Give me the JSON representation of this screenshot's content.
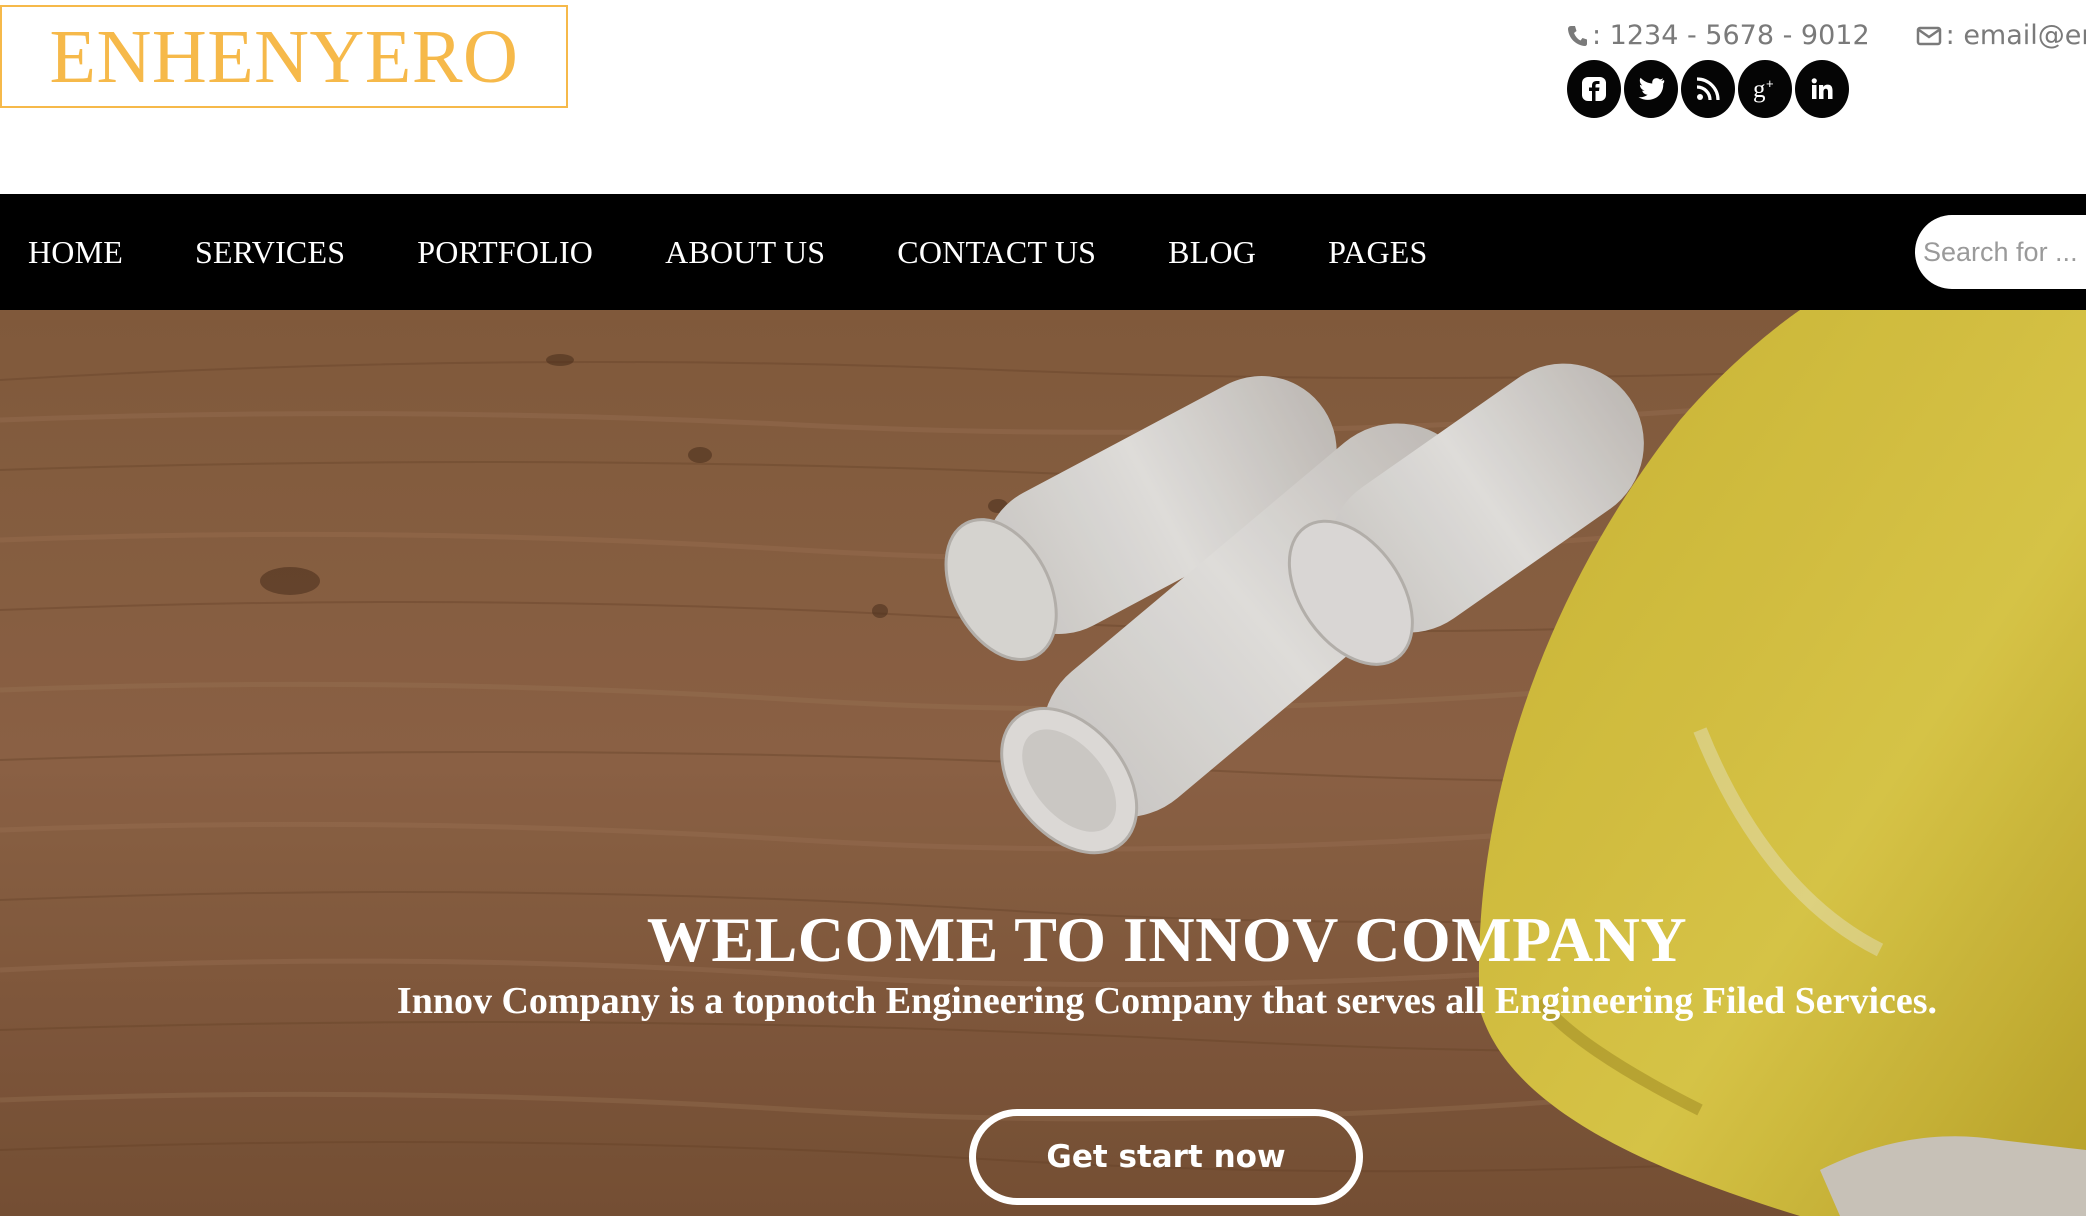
{
  "header": {
    "logo_text": "ENHENYERO",
    "phone": ": 1234 - 5678 - 9012",
    "email": ": email@en",
    "socials": [
      {
        "icon": "facebook-icon"
      },
      {
        "icon": "twitter-icon"
      },
      {
        "icon": "rss-icon"
      },
      {
        "icon": "google-plus-icon"
      },
      {
        "icon": "linkedin-icon"
      }
    ]
  },
  "nav": {
    "items": [
      "HOME",
      "SERVICES",
      "PORTFOLIO",
      "ABOUT US",
      "CONTACT US",
      "BLOG",
      "PAGES"
    ],
    "search_placeholder": "Search for ..."
  },
  "hero": {
    "title": "WELCOME TO INNOV COMPANY",
    "subtitle": "Innov Company is a topnotch Engineering Company that serves all Engineering Filed Services.",
    "button_label": "Get start now"
  },
  "colors": {
    "accent": "#f6b94a",
    "nav_bg": "#000000",
    "social_bg": "#050505",
    "contact_text": "#7a7a7a"
  }
}
